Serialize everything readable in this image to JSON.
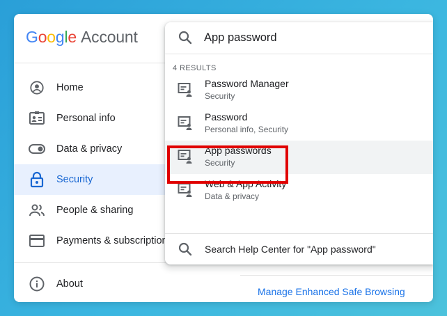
{
  "app": {
    "logo_letters": [
      "G",
      "o",
      "o",
      "g",
      "l",
      "e"
    ],
    "logo_suffix": "Account"
  },
  "sidebar": {
    "items": [
      {
        "label": "Home",
        "icon": "account-circle-icon"
      },
      {
        "label": "Personal info",
        "icon": "id-card-icon"
      },
      {
        "label": "Data & privacy",
        "icon": "toggle-icon"
      },
      {
        "label": "Security",
        "icon": "lock-icon",
        "active": true
      },
      {
        "label": "People & sharing",
        "icon": "people-icon"
      },
      {
        "label": "Payments & subscriptions",
        "icon": "credit-card-icon"
      }
    ],
    "about": {
      "label": "About",
      "icon": "info-icon"
    }
  },
  "search": {
    "value": "App password",
    "results_count": "4 RESULTS",
    "results": [
      {
        "title": "Password Manager",
        "subtitle": "Security"
      },
      {
        "title": "Password",
        "subtitle": "Personal info, Security"
      },
      {
        "title": "App passwords",
        "subtitle": "Security",
        "highlighted": true
      },
      {
        "title": "Web & App Activity",
        "subtitle": "Data & privacy"
      }
    ],
    "help_center": "Search Help Center for \"App password\""
  },
  "main": {
    "manage_link": "Manage Enhanced Safe Browsing"
  },
  "colors": {
    "accent": "#1a73e8",
    "active_bg": "#e8f0fe",
    "highlight_box": "#e00000",
    "background": "#2a9fd8"
  }
}
